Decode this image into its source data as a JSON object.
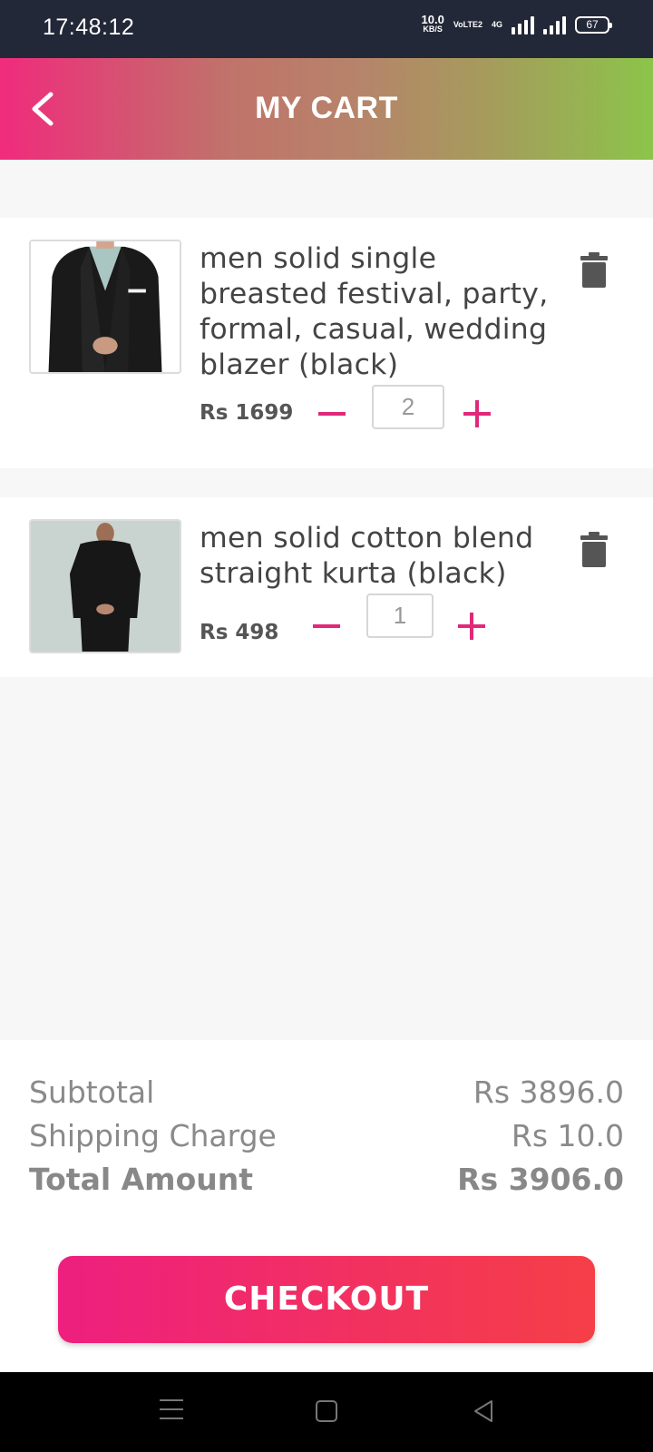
{
  "status_bar": {
    "time": "17:48:12",
    "net_speed": "10.0",
    "net_unit": "KB/S",
    "volte": "VoLTE2",
    "network": "4G",
    "battery": "67"
  },
  "header": {
    "title": "MY CART",
    "back_icon": "chevron-left-icon"
  },
  "cart": {
    "items": [
      {
        "title": "men solid single breasted festival, party, formal, casual, wedding blazer (black)",
        "price": "Rs 1699",
        "quantity": "2",
        "image": "blazer-photo",
        "delete_icon": "trash-icon"
      },
      {
        "title": "men solid cotton blend straight kurta (black)",
        "price": "Rs 498",
        "quantity": "1",
        "image": "kurta-photo",
        "delete_icon": "trash-icon"
      }
    ]
  },
  "summary": {
    "subtotal_label": "Subtotal",
    "subtotal_value": "Rs 3896.0",
    "shipping_label": "Shipping Charge",
    "shipping_value": "Rs 10.0",
    "total_label": "Total Amount",
    "total_value": "Rs 3906.0"
  },
  "checkout": {
    "label": "CHECKOUT"
  },
  "colors": {
    "accent": "#e0297a",
    "header_start": "#f02b7c",
    "header_end": "#8cc44a",
    "checkout_start": "#ee1f7f",
    "checkout_end": "#f53f47"
  }
}
